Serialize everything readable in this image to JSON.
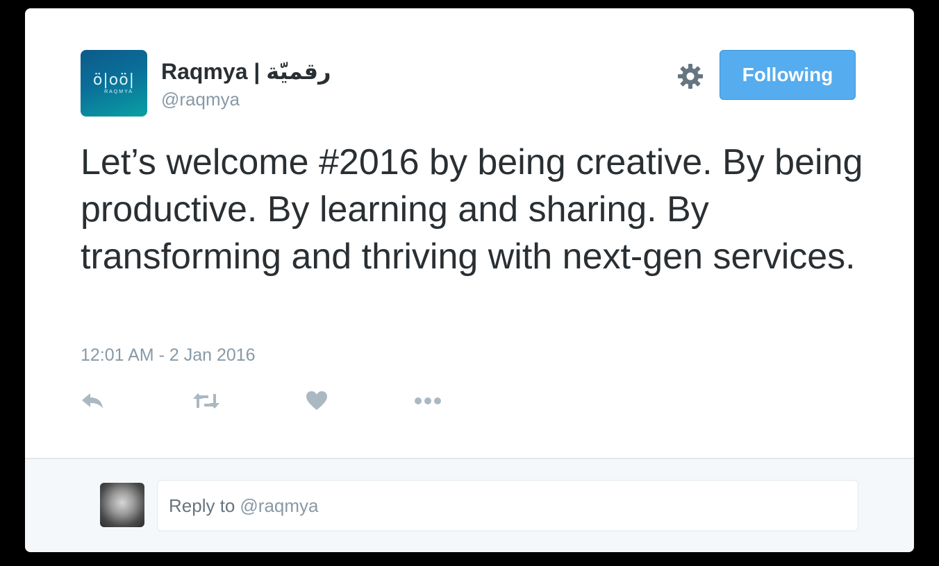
{
  "author": {
    "name": "Raqmya | رقميّة",
    "handle": "@raqmya",
    "logo_mark": "ö|oö|",
    "logo_word": "RAQMYA"
  },
  "follow_button": {
    "label": "Following"
  },
  "tweet": {
    "text": "Let’s welcome #2016 by being creative. By being productive. By learning and sharing. By transforming and thriving with next-gen services.",
    "timestamp": "12:01 AM - 2 Jan 2016"
  },
  "actions": {
    "icons": [
      "reply-icon",
      "retweet-icon",
      "heart-icon",
      "more-icon"
    ]
  },
  "reply": {
    "prefix": "Reply to",
    "handle": "@raqmya"
  },
  "colors": {
    "accent": "#55acee",
    "text": "#292f33",
    "muted": "#8899a6",
    "icon": "#aab8c2"
  }
}
